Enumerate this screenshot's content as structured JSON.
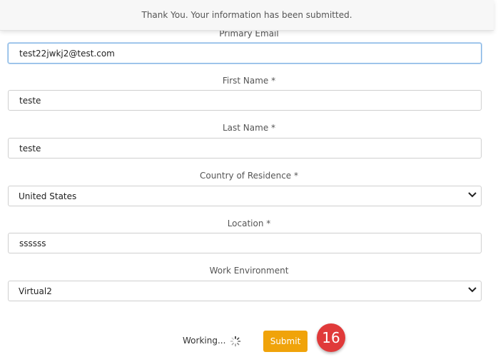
{
  "toast": {
    "message": "Thank You. Your information has been submitted."
  },
  "form": {
    "primary_email": {
      "label": "Primary Email",
      "value": "test22jwkj2@test.com"
    },
    "first_name": {
      "label": "First Name *",
      "value": "teste"
    },
    "last_name": {
      "label": "Last Name *",
      "value": "teste"
    },
    "country": {
      "label": "Country of Residence *",
      "value": "United States"
    },
    "location": {
      "label": "Location *",
      "value": "ssssss"
    },
    "work_environment": {
      "label": "Work Environment",
      "value": "Virtual2"
    }
  },
  "footer": {
    "working_text": "Working...",
    "submit_label": "Submit",
    "step_badge": "16"
  },
  "colors": {
    "submit_bg": "#f0a30a",
    "badge_bg": "#e03a3a"
  }
}
